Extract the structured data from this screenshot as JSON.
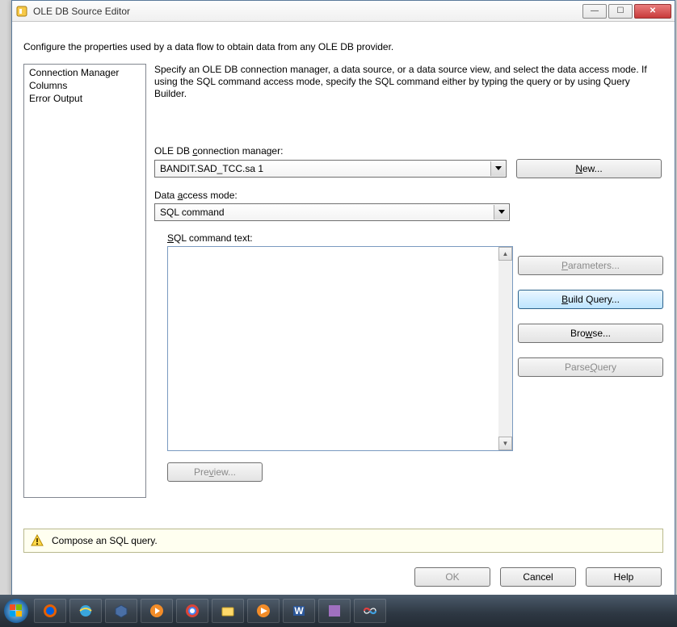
{
  "window": {
    "title": "OLE DB Source Editor"
  },
  "config_text": "Configure the properties used by a data flow to obtain data from any OLE DB provider.",
  "nav": {
    "items": [
      "Connection Manager",
      "Columns",
      "Error Output"
    ]
  },
  "desc": "Specify an OLE DB connection manager, a data source, or a data source view, and select the data access mode. If using the SQL command access mode, specify the SQL command either by typing the query or by using Query Builder.",
  "labels": {
    "conn": "OLE DB connection manager:",
    "mode": "Data access mode:",
    "sqltext": "SQL command text:"
  },
  "values": {
    "conn": "BANDIT.SAD_TCC.sa 1",
    "mode": "SQL command",
    "sqltext": ""
  },
  "buttons": {
    "new": "New...",
    "parameters": "Parameters...",
    "build": "Build Query...",
    "browse": "Browse...",
    "parse": "Parse Query",
    "preview": "Preview...",
    "ok": "OK",
    "cancel": "Cancel",
    "help": "Help"
  },
  "status": {
    "text": "Compose an SQL query."
  },
  "taskbar": {
    "apps": [
      "firefox",
      "ie",
      "visual-studio",
      "media-player",
      "chrome",
      "explorer",
      "windows-media",
      "word",
      "misc",
      "paint"
    ]
  }
}
